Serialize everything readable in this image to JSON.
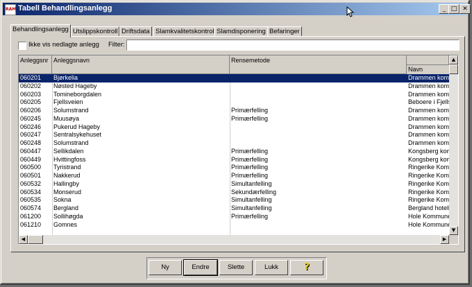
{
  "window": {
    "title": "Tabell  Behandlingsanlegg",
    "icon_text": "RAM"
  },
  "titlebar_buttons": {
    "minimize": "_",
    "maximize": "□",
    "close": "✕"
  },
  "tabs": [
    {
      "label": "Behandlingsanlegg",
      "active": true
    },
    {
      "label": "Utslippskontroll",
      "active": false
    },
    {
      "label": "Driftsdata",
      "active": false
    },
    {
      "label": "Slamkvalitetskontroll",
      "active": false
    },
    {
      "label": "Slamdisponering",
      "active": false
    },
    {
      "label": "Befaringer",
      "active": false
    }
  ],
  "filters": {
    "checkbox_label": "Ikke vis nedlagte anlegg",
    "checkbox_checked": false,
    "filter_label": "Filter:",
    "filter_value": ""
  },
  "table": {
    "columns": [
      "Anleggsnr",
      "Anleggsnavn",
      "Rensemetode",
      ""
    ],
    "sub_header": "Navn",
    "rows": [
      {
        "nr": "060201",
        "navn": "Bjørkelia",
        "metode": "",
        "eier": "Drammen komm"
      },
      {
        "nr": "060202",
        "navn": "Nøsted Hageby",
        "metode": "",
        "eier": "Drammen komm"
      },
      {
        "nr": "060203",
        "navn": "Tomineborgdalen",
        "metode": "",
        "eier": "Drammen komm"
      },
      {
        "nr": "060205",
        "navn": "Fjellsveien",
        "metode": "",
        "eier": "Beboere i Fjells"
      },
      {
        "nr": "060206",
        "navn": "Solumstrand",
        "metode": "Primærfelling",
        "eier": "Drammen komm"
      },
      {
        "nr": "060245",
        "navn": "Muusøya",
        "metode": "Primærfelling",
        "eier": "Drammen komm"
      },
      {
        "nr": "060246",
        "navn": "Pukerud Hageby",
        "metode": "",
        "eier": "Drammen komm"
      },
      {
        "nr": "060247",
        "navn": "Sentralsykehuset",
        "metode": "",
        "eier": "Drammen komm"
      },
      {
        "nr": "060248",
        "navn": "Solumstrand",
        "metode": "",
        "eier": "Drammen komm"
      },
      {
        "nr": "060447",
        "navn": "Sellikdalen",
        "metode": "Primærfelling",
        "eier": "Kongsberg kom"
      },
      {
        "nr": "060449",
        "navn": "Hvittingfoss",
        "metode": "Primærfelling",
        "eier": "Kongsberg kom"
      },
      {
        "nr": "060500",
        "navn": "Tyristrand",
        "metode": "Primærfelling",
        "eier": "Ringerike Komr"
      },
      {
        "nr": "060501",
        "navn": "Nakkerud",
        "metode": "Primærfelling",
        "eier": "Ringerike Komr"
      },
      {
        "nr": "060532",
        "navn": "Hallingby",
        "metode": "Simultanfelling",
        "eier": "Ringerike Komr"
      },
      {
        "nr": "060534",
        "navn": "Monserud",
        "metode": "Sekundærfelling",
        "eier": "Ringerike Komr"
      },
      {
        "nr": "060535",
        "navn": "Sokna",
        "metode": "Simultanfelling",
        "eier": "Ringerike Komr"
      },
      {
        "nr": "060574",
        "navn": "Bergland",
        "metode": "Simultanfelling",
        "eier": "Bergland hotell"
      },
      {
        "nr": "061200",
        "navn": "Sollihøgda",
        "metode": "Primærfelling",
        "eier": "Hole Kommune"
      },
      {
        "nr": "061210",
        "navn": "Gomnes",
        "metode": "",
        "eier": "Hole Kommune"
      }
    ],
    "selected_index": 0
  },
  "scroll_glyphs": {
    "up": "▲",
    "down": "▼",
    "left": "◀",
    "right": "▶"
  },
  "buttons": {
    "ny": "Ny",
    "endre": "Endre",
    "slette": "Slette",
    "lukk": "Lukk",
    "help": "?"
  },
  "colors": {
    "title_active": "#0a246a",
    "selection": "#0a246a",
    "face": "#d4d0c8",
    "help_icon": "#e8c800"
  }
}
